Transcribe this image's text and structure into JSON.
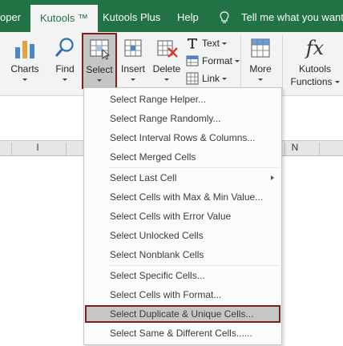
{
  "tabs": {
    "developer_partial": "oper",
    "kutools": "Kutools ™",
    "kutools_plus": "Kutools Plus",
    "help": "Help",
    "tell_me": "Tell me what you want t"
  },
  "ribbon": {
    "charts": "Charts",
    "find": "Find",
    "select": "Select",
    "insert": "Insert",
    "delete": "Delete",
    "text": "Text",
    "format": "Format",
    "link": "Link",
    "more": "More",
    "kutools_functions_line1": "Kutools",
    "kutools_functions_line2": "Functions"
  },
  "columns": {
    "i": "I",
    "n": "N"
  },
  "menu": {
    "items": [
      "Select Range Helper...",
      "Select Range Randomly...",
      "Select Interval Rows & Columns...",
      "Select Merged Cells",
      "Select Last Cell",
      "Select Cells with Max & Min Value...",
      "Select Cells with Error Value",
      "Select Unlocked Cells",
      "Select Nonblank Cells",
      "Select Specific Cells...",
      "Select Cells with Format...",
      "Select Duplicate & Unique Cells...",
      "Select Same & Different Cells......"
    ],
    "highlighted_index": 11,
    "submenu_index": 4
  },
  "colors": {
    "accent_green": "#217346",
    "highlight_border": "#7b1f1f",
    "menu_highlight": "#c6c6c6"
  }
}
